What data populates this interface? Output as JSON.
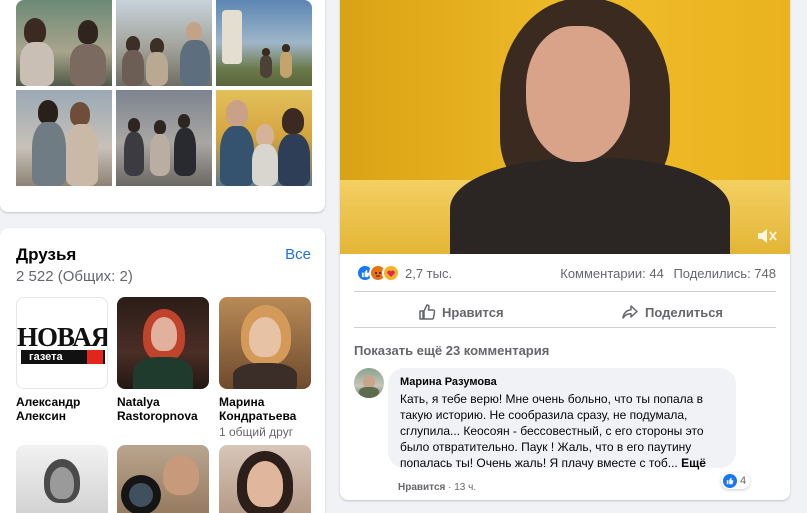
{
  "photos": {
    "items": [
      "photo-1",
      "photo-2",
      "photo-3",
      "photo-4",
      "photo-5",
      "photo-6"
    ]
  },
  "friends": {
    "title": "Друзья",
    "all_link": "Все",
    "count": "2 522 (Общих: 2)",
    "items": [
      {
        "name_line1": "Александр",
        "name_line2": "Алексин",
        "mutual": ""
      },
      {
        "name_line1": "Natalya",
        "name_line2": "Rastoropnova",
        "mutual": ""
      },
      {
        "name_line1": "Марина",
        "name_line2": "Кондратьева",
        "mutual": "1 общий друг"
      }
    ],
    "logo_text_top": "НОВАЯ",
    "logo_text_bottom": "газета"
  },
  "post": {
    "reactions": {
      "icons": [
        "like-icon",
        "angry-icon",
        "care-icon"
      ],
      "count": "2,7 тыс."
    },
    "comments_stat": "Комментарии: 44",
    "shares_stat": "Поделились: 748",
    "like_button": "Нравится",
    "share_button": "Поделиться",
    "more_comments": "Показать ещё 23 комментария",
    "comment": {
      "author": "Марина Разумова",
      "text": "Кать, я тебе верю! Мне очень больно, что ты попала в такую историю. Не сообразила сразу, не подумала, сглупила... Кеосоян - бессовестный, с его стороны это было отвратительно. Паук ! Жаль, что в его паутину попалась ты! Очень жаль! Я плачу вместе с тоб...",
      "see_more": "Ещё",
      "like_action": "Нравится",
      "time": "13 ч.",
      "likes": "4"
    }
  },
  "colors": {
    "accent": "#1877f2",
    "link": "#216fdb",
    "bg": "#f0f2f5",
    "video_wall": "#e8b21f"
  }
}
